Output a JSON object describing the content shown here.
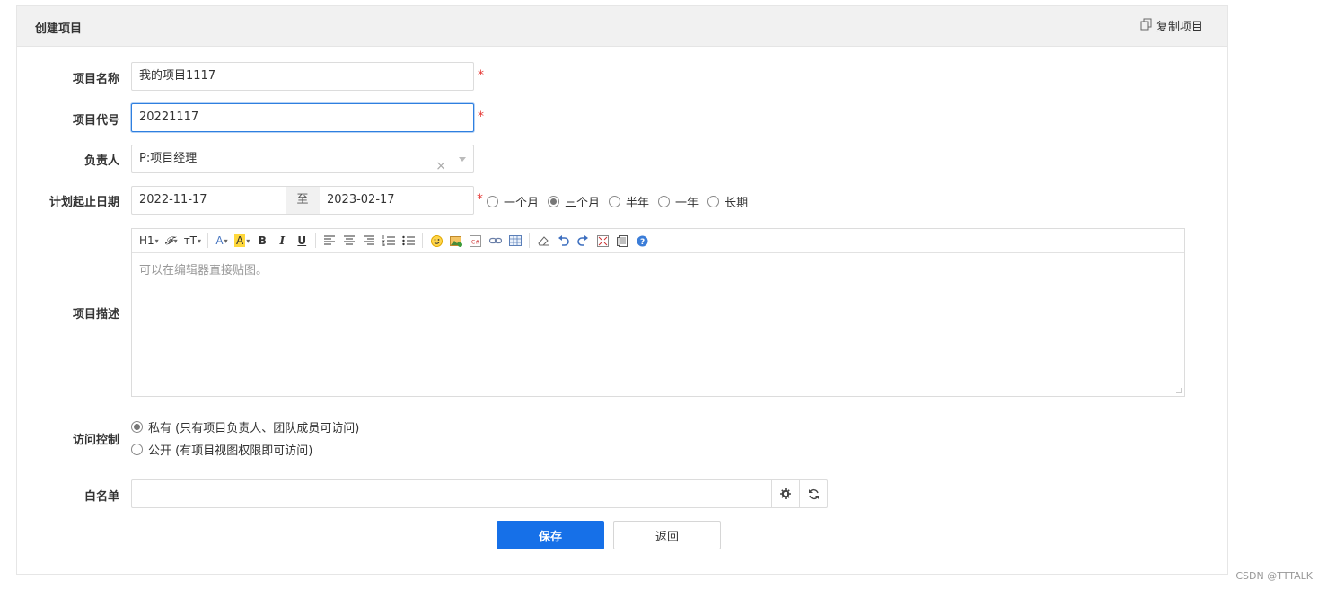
{
  "panel": {
    "title": "创建项目",
    "copy_label": "复制项目"
  },
  "form": {
    "name": {
      "label": "项目名称",
      "value": "我的项目1117",
      "required_mark": "*"
    },
    "code": {
      "label": "项目代号",
      "value": "20221117",
      "required_mark": "*"
    },
    "owner": {
      "label": "负责人",
      "value": "P:项目经理",
      "clear": "×"
    },
    "dates": {
      "label": "计划起止日期",
      "start": "2022-11-17",
      "separator": "至",
      "end": "2023-02-17",
      "required_mark": "*",
      "options": [
        {
          "label": "一个月",
          "selected": false
        },
        {
          "label": "三个月",
          "selected": true
        },
        {
          "label": "半年",
          "selected": false
        },
        {
          "label": "一年",
          "selected": false
        },
        {
          "label": "长期",
          "selected": false
        }
      ]
    },
    "description": {
      "label": "项目描述",
      "placeholder": "可以在编辑器直接贴图。",
      "toolbar": {
        "heading": "H1",
        "font": "𝓕",
        "font_size": "тT",
        "font_color": "A",
        "bg_color": "A",
        "bold": "B",
        "italic": "I",
        "underline": "U"
      }
    },
    "access": {
      "label": "访问控制",
      "options": [
        {
          "label": "私有 (只有项目负责人、团队成员可访问)",
          "selected": true
        },
        {
          "label": "公开 (有项目视图权限即可访问)",
          "selected": false
        }
      ]
    },
    "whitelist": {
      "label": "白名单",
      "value": ""
    }
  },
  "actions": {
    "save": "保存",
    "back": "返回"
  },
  "watermark": "CSDN @TTTALK",
  "colors": {
    "primary": "#1670e8",
    "required": "#e53935",
    "focus_border": "#2e7fe0"
  }
}
